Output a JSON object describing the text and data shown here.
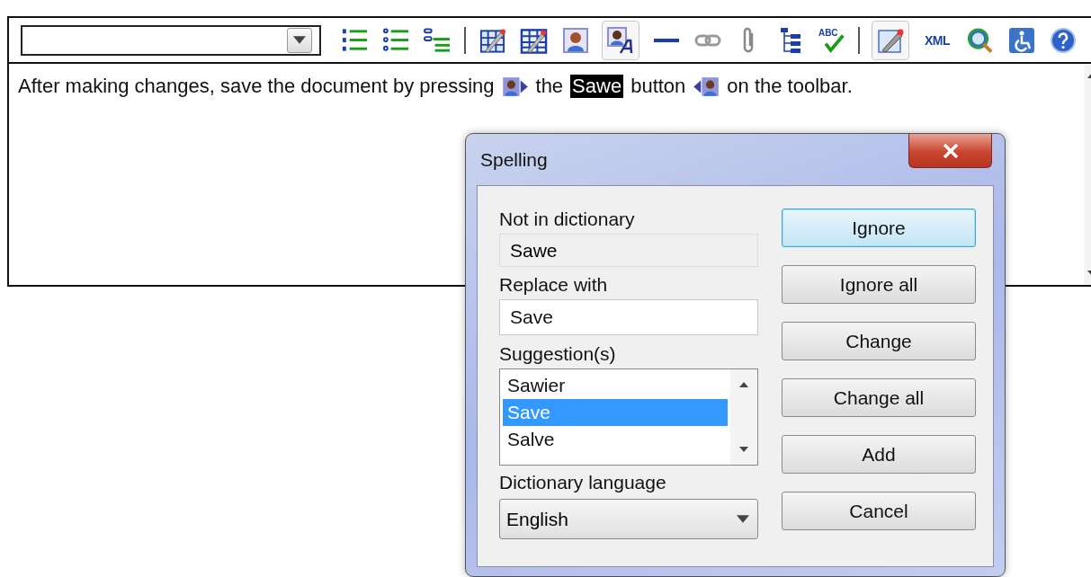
{
  "toolbar": {
    "items": [
      {
        "kind": "numbered-list",
        "pressed": false
      },
      {
        "kind": "bullet-list",
        "pressed": false
      },
      {
        "kind": "outline-list",
        "pressed": false
      },
      {
        "kind": "separator"
      },
      {
        "kind": "table-edit",
        "pressed": false
      },
      {
        "kind": "table-grid",
        "pressed": false
      },
      {
        "kind": "image",
        "pressed": false
      },
      {
        "kind": "image-text",
        "pressed": true
      },
      {
        "kind": "rule",
        "pressed": false
      },
      {
        "kind": "link",
        "pressed": false
      },
      {
        "kind": "attachment",
        "pressed": false
      },
      {
        "kind": "tree",
        "pressed": false
      },
      {
        "kind": "spellcheck",
        "pressed": false,
        "label": "ABC"
      },
      {
        "kind": "separator"
      },
      {
        "kind": "edit",
        "pressed": true
      },
      {
        "kind": "xml",
        "pressed": false,
        "label": "XML"
      },
      {
        "kind": "web-search",
        "pressed": false
      },
      {
        "kind": "accessibility",
        "pressed": false
      },
      {
        "kind": "help",
        "pressed": false
      }
    ]
  },
  "document": {
    "segments": [
      {
        "kind": "text",
        "text": "After making changes, save the document by pressing"
      },
      {
        "kind": "marker-start"
      },
      {
        "kind": "text",
        "text": "the"
      },
      {
        "kind": "misspelled",
        "text": "Sawe"
      },
      {
        "kind": "text",
        "text": "button"
      },
      {
        "kind": "marker-end"
      },
      {
        "kind": "text",
        "text": "on the toolbar."
      }
    ]
  },
  "dialog": {
    "title": "Spelling",
    "not_in_dictionary": {
      "label": "Not in dictionary",
      "value": "Sawe"
    },
    "replace_with": {
      "label": "Replace with",
      "value": "Save"
    },
    "suggestions": {
      "label": "Suggestion(s)",
      "items": [
        {
          "text": "Sawier",
          "selected": false
        },
        {
          "text": "Save",
          "selected": true
        },
        {
          "text": "Salve",
          "selected": false
        }
      ]
    },
    "dictionary_language": {
      "label": "Dictionary language",
      "value": "English"
    },
    "buttons": [
      {
        "label": "Ignore",
        "default": true
      },
      {
        "label": "Ignore all",
        "default": false
      },
      {
        "label": "Change",
        "default": false
      },
      {
        "label": "Change all",
        "default": false
      },
      {
        "label": "Add",
        "default": false
      },
      {
        "label": "Cancel",
        "default": false
      }
    ]
  }
}
